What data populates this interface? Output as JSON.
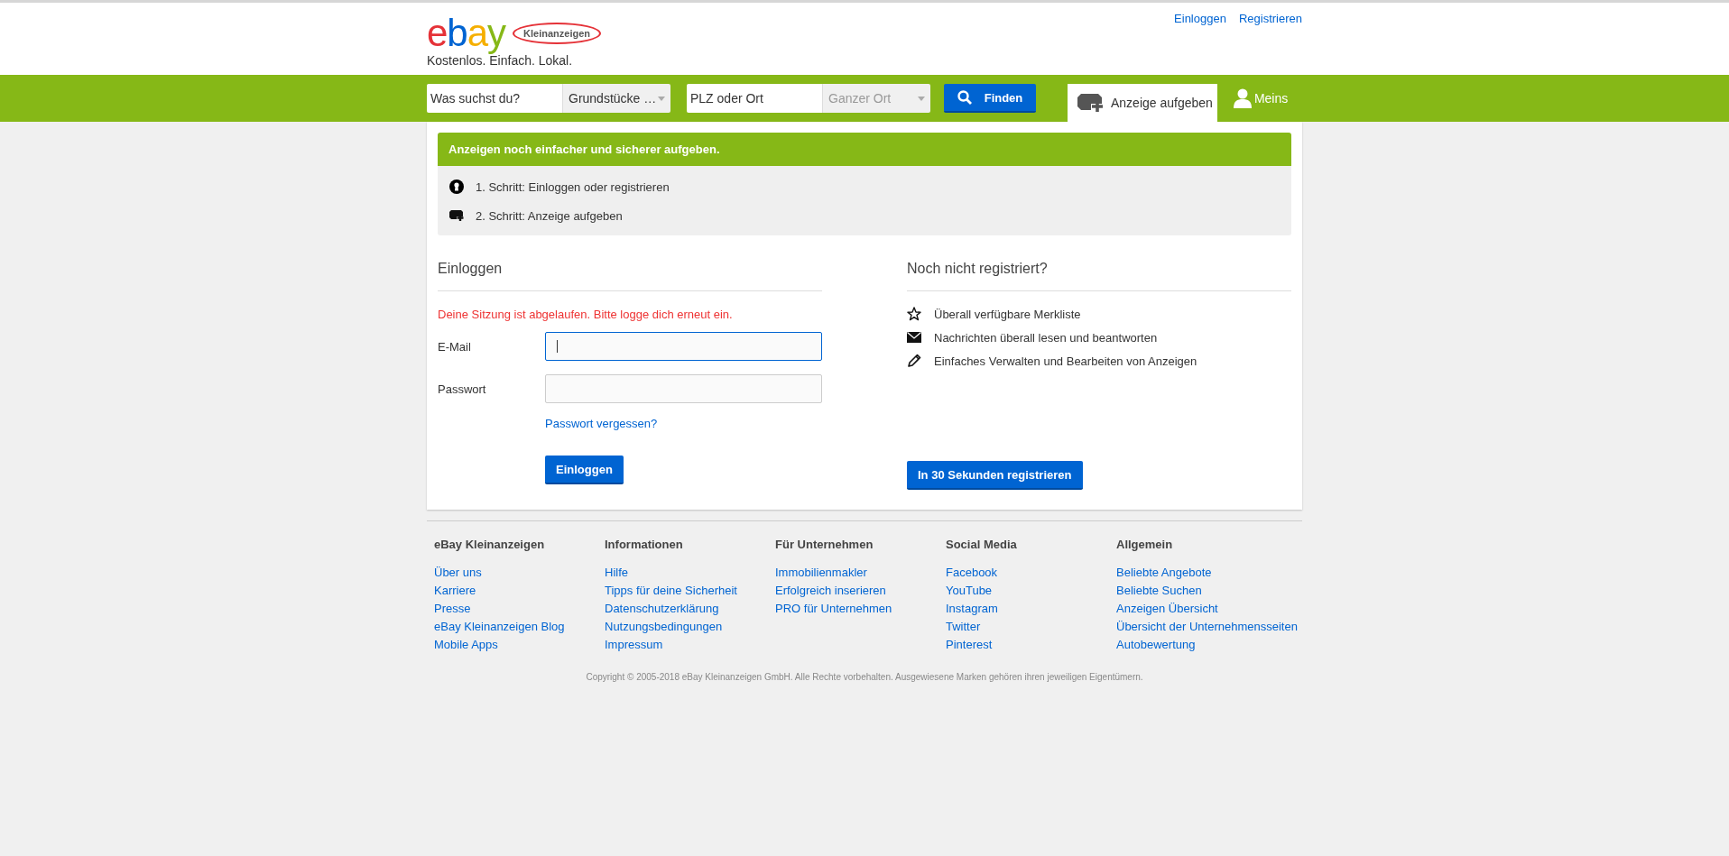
{
  "header": {
    "logo": {
      "brand": "ebay",
      "badge": "Kleinanzeigen"
    },
    "tagline": "Kostenlos. Einfach. Lokal.",
    "links": [
      "Einloggen",
      "Registrieren"
    ]
  },
  "search_bar": {
    "query": {
      "placeholder": "Was suchst du?"
    },
    "category": {
      "value": "Grundstücke …",
      "disabled": false
    },
    "location": {
      "placeholder": "PLZ oder Ort"
    },
    "radius": {
      "value": "Ganzer Ort",
      "disabled": true
    },
    "button": "Finden",
    "post_tab": {
      "label": "Anzeige aufgeben",
      "selected": true
    },
    "account": "Meins"
  },
  "steps_panel": {
    "title": "Anzeigen noch einfacher und sicherer aufgeben.",
    "steps": [
      {
        "kind": "keyhole",
        "text": "1. Schritt: Einloggen oder registrieren"
      },
      {
        "kind": "post",
        "text": "2. Schritt: Anzeige aufgeben"
      }
    ]
  },
  "login": {
    "heading": "Einloggen",
    "error": "Deine Sitzung ist abgelaufen. Bitte logge dich erneut ein.",
    "fields": [
      {
        "label": "E-Mail",
        "focused": true
      },
      {
        "label": "Passwort",
        "focused": false
      }
    ],
    "forgot_link": "Passwort vergessen?",
    "button": "Einloggen"
  },
  "register": {
    "heading": "Noch nicht registriert?",
    "benefits": [
      {
        "kind": "star",
        "text": "Überall verfügbare Merkliste"
      },
      {
        "kind": "mail",
        "text": "Nachrichten überall lesen und beantworten"
      },
      {
        "kind": "pencil",
        "text": "Einfaches Verwalten und Bearbeiten von Anzeigen"
      }
    ],
    "button": "In 30 Sekunden registrieren"
  },
  "footer": {
    "columns": [
      {
        "heading": "eBay Kleinanzeigen",
        "links": [
          "Über uns",
          "Karriere",
          "Presse",
          "eBay Kleinanzeigen Blog",
          "Mobile Apps"
        ]
      },
      {
        "heading": "Informationen",
        "links": [
          "Hilfe",
          "Tipps für deine Sicherheit",
          "Datenschutzerklärung",
          "Nutzungsbedingungen",
          "Impressum"
        ]
      },
      {
        "heading": "Für Unternehmen",
        "links": [
          "Immobilienmakler",
          "Erfolgreich inserieren",
          "PRO für Unternehmen"
        ]
      },
      {
        "heading": "Social Media",
        "links": [
          "Facebook",
          "YouTube",
          "Instagram",
          "Twitter",
          "Pinterest"
        ]
      },
      {
        "heading": "Allgemein",
        "links": [
          "Beliebte Angebote",
          "Beliebte Suchen",
          "Anzeigen Übersicht",
          "Übersicht der Unternehmensseiten",
          "Autobewertung"
        ]
      }
    ],
    "copyright": "Copyright © 2005-2018 eBay Kleinanzeigen GmbH. Alle Rechte vorbehalten. Ausgewiesene Marken gehören ihren jeweiligen Eigentümern."
  }
}
